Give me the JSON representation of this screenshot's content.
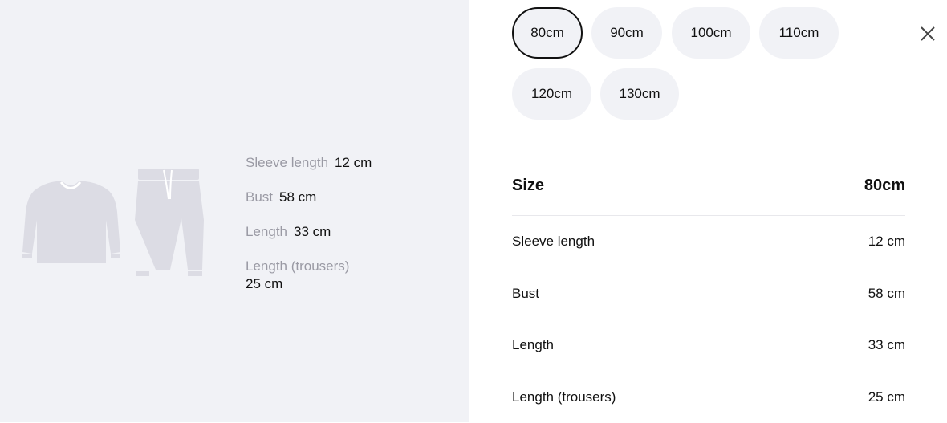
{
  "illustration": {
    "top_icon": "sweater-icon",
    "bottom_icon": "trousers-icon"
  },
  "specs": [
    {
      "label": "Sleeve length",
      "value": "12 cm"
    },
    {
      "label": "Bust",
      "value": "58 cm"
    },
    {
      "label": "Length",
      "value": "33 cm"
    },
    {
      "label": "Length (trousers)",
      "value": "25 cm"
    }
  ],
  "sizes": {
    "options": [
      "80cm",
      "90cm",
      "100cm",
      "110cm",
      "120cm",
      "130cm"
    ],
    "selected": "80cm"
  },
  "table": {
    "header_label": "Size",
    "header_value": "80cm",
    "rows": [
      {
        "label": "Sleeve length",
        "value": "12 cm"
      },
      {
        "label": "Bust",
        "value": "58 cm"
      },
      {
        "label": "Length",
        "value": "33 cm"
      },
      {
        "label": "Length (trousers)",
        "value": "25 cm"
      }
    ]
  },
  "colors": {
    "panel_bg": "#f1f2f6",
    "illustration": "#dcdce4",
    "muted_text": "#9a9aa4",
    "selected_border": "#111111"
  }
}
